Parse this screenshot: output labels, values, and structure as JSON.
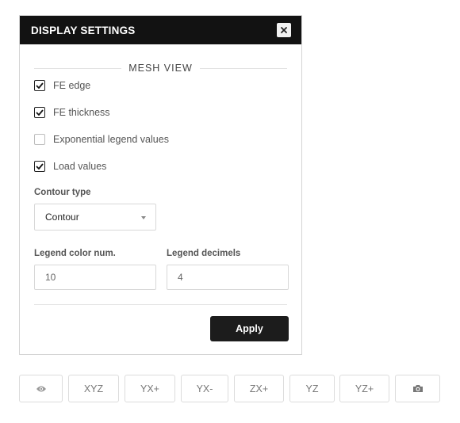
{
  "panel": {
    "title": "DISPLAY SETTINGS",
    "close_icon": "close-icon",
    "section_title": "MESH VIEW",
    "checkboxes": [
      {
        "label": "FE edge",
        "checked": true
      },
      {
        "label": "FE thickness",
        "checked": true
      },
      {
        "label": "Exponential legend values",
        "checked": false
      },
      {
        "label": "Load values",
        "checked": true
      }
    ],
    "contour_type": {
      "label": "Contour type",
      "value": "Contour"
    },
    "legend_color_num": {
      "label": "Legend color num.",
      "value": "10"
    },
    "legend_decimels": {
      "label": "Legend decimels",
      "value": "4"
    },
    "apply_label": "Apply"
  },
  "view_toolbar": {
    "buttons": [
      {
        "icon": "eye-icon",
        "label": ""
      },
      {
        "label": "XYZ"
      },
      {
        "label": "YX+"
      },
      {
        "label": "YX-"
      },
      {
        "label": "ZX+"
      },
      {
        "label": "YZ"
      },
      {
        "label": "YZ+"
      },
      {
        "icon": "camera-icon",
        "label": ""
      }
    ]
  },
  "colors": {
    "header_bg": "#121212",
    "apply_bg": "#1c1c1c"
  }
}
